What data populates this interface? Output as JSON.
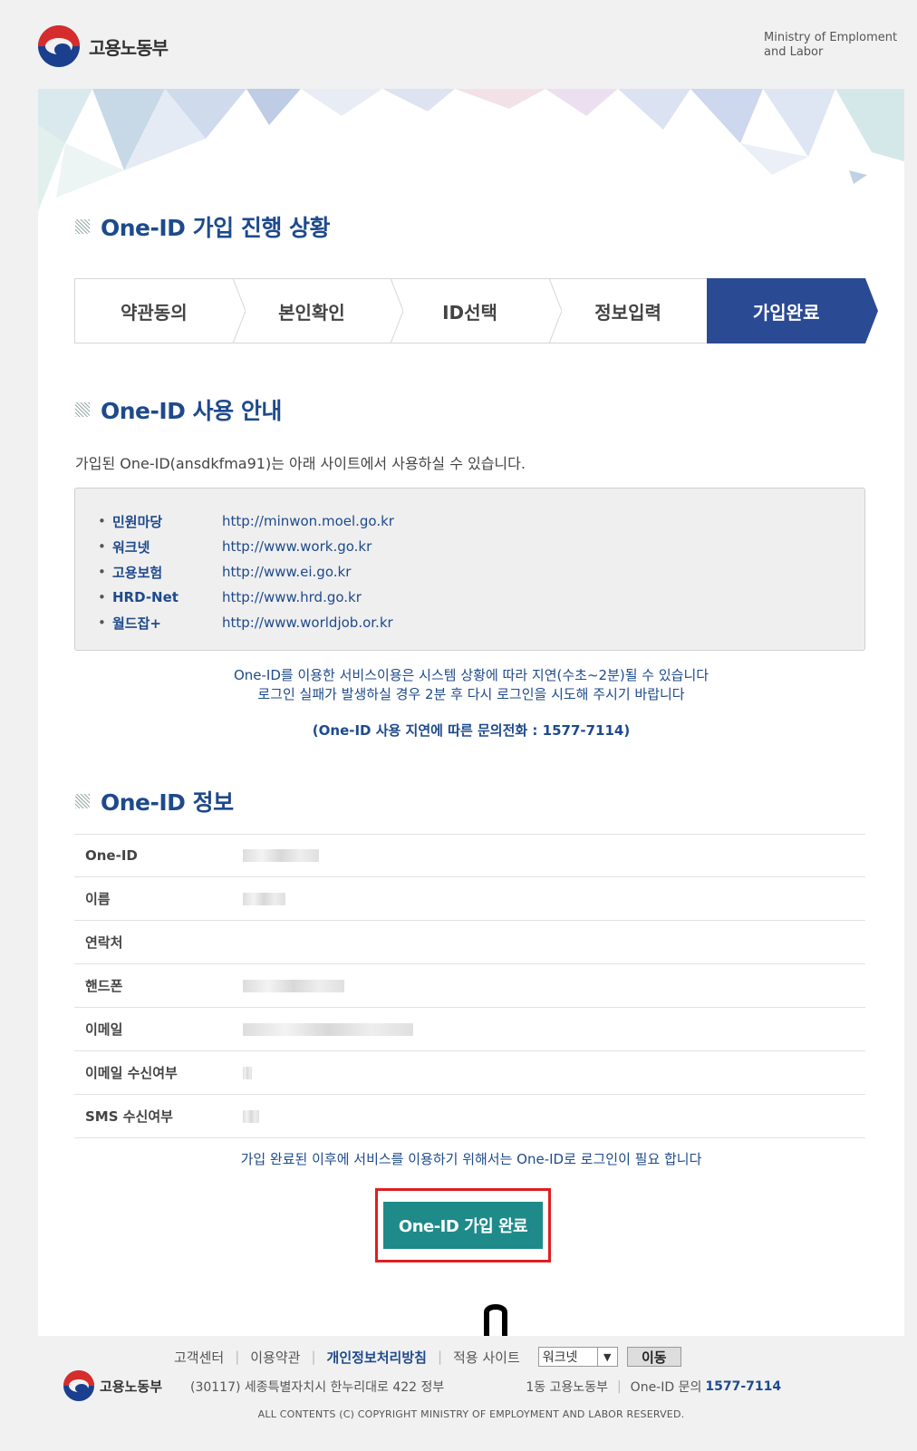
{
  "header": {
    "logo_text": "고용노동부",
    "ministry_en_line1": "Ministry of Emploment",
    "ministry_en_line2": "and Labor"
  },
  "progress": {
    "title": "One-ID 가입 진행 상황",
    "steps": [
      {
        "label": "약관동의",
        "active": false
      },
      {
        "label": "본인확인",
        "active": false
      },
      {
        "label": "ID선택",
        "active": false
      },
      {
        "label": "정보입력",
        "active": false
      },
      {
        "label": "가입완료",
        "active": true
      }
    ]
  },
  "usage": {
    "title": "One-ID 사용 안내",
    "intro": "가입된 One-ID(ansdkfma91)는 아래 사이트에서 사용하실 수 있습니다.",
    "sites": [
      {
        "name": "민원마당",
        "url": "http://minwon.moel.go.kr"
      },
      {
        "name": "워크넷",
        "url": "http://www.work.go.kr"
      },
      {
        "name": "고용보험",
        "url": "http://www.ei.go.kr"
      },
      {
        "name": "HRD-Net",
        "url": "http://www.hrd.go.kr"
      },
      {
        "name": "월드잡+",
        "url": "http://www.worldjob.or.kr"
      }
    ],
    "notice_line1": "One-ID를 이용한 서비스이용은 시스템 상황에 따라 지연(수초~2분)될 수 있습니다",
    "notice_line2": "로그인 실패가 발생하실 경우 2분 후 다시 로그인을 시도해 주시기 바랍니다",
    "notice_phone": "(One-ID 사용 지연에 따른 문의전화 : 1577-7114)"
  },
  "info": {
    "title": "One-ID 정보",
    "rows": [
      {
        "label": "One-ID"
      },
      {
        "label": "이름"
      },
      {
        "label": "연락처"
      },
      {
        "label": "핸드폰"
      },
      {
        "label": "이메일"
      },
      {
        "label": "이메일 수신여부"
      },
      {
        "label": "SMS 수신여부"
      }
    ],
    "login_notice": "가입 완료된 이후에 서비스를 이용하기 위해서는 One-ID로 로그인이 필요 합니다",
    "complete_button": "One-ID 가입 완료"
  },
  "footer": {
    "links": [
      "고객센터",
      "이용약관",
      "개인정보처리방침"
    ],
    "apply_site_label": "적용 사이트",
    "select_value": "워크넷",
    "go_button": "이동",
    "logo_text": "고용노동부",
    "address": "(30117) 세종특별자치시 한누리대로 422 정부",
    "building": "1동 고용노동부",
    "inquiry_label": "One-ID 문의",
    "inquiry_phone": "1577-7114",
    "copyright": "ALL CONTENTS (C) COPYRIGHT MINISTRY OF EMPLOYMENT AND LABOR RESERVED."
  },
  "colors": {
    "brand_blue": "#1e4a8c",
    "active_step": "#2a4a94",
    "complete_button": "#1e8a8a",
    "highlight_border": "#e01e1e"
  }
}
